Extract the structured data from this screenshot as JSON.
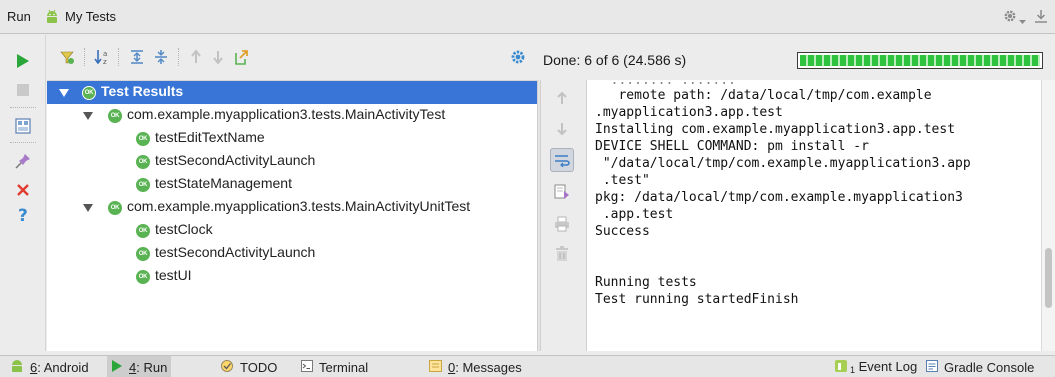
{
  "window": {
    "tool_label": "Run",
    "config_name": "My Tests",
    "icons": [
      "android-icon",
      "gear-icon",
      "hide-icon"
    ]
  },
  "left_toolbar": {
    "buttons": [
      "rerun-icon",
      "stop-icon",
      "layout-icon",
      "pin-icon",
      "close-icon",
      "help-icon"
    ]
  },
  "tree_toolbar": {
    "buttons": [
      "hide-passed-icon",
      "sort-alpha-icon",
      "expand-all-icon",
      "collapse-all-icon",
      "prev-failed-icon",
      "next-failed-icon",
      "export-icon",
      "settings-icon"
    ]
  },
  "tree": {
    "badge": "OK",
    "root": "Test Results",
    "groups": [
      {
        "name": "com.example.myapplication3.tests.MainActivityTest",
        "tests": [
          "testEditTextName",
          "testSecondActivityLaunch",
          "testStateManagement"
        ]
      },
      {
        "name": "com.example.myapplication3.tests.MainActivityUnitTest",
        "tests": [
          "testClock",
          "testSecondActivityLaunch",
          "testUI"
        ]
      }
    ]
  },
  "status": {
    "text": "Done: 6 of 6  (24.586 s)",
    "progress": 1.0,
    "progress_color": "#2fc23e"
  },
  "console": {
    "lines": [
      "   remote path: /data/local/tmp/com.example",
      ".myapplication3.app.test",
      "Installing com.example.myapplication3.app.test",
      "DEVICE SHELL COMMAND: pm install -r",
      " \"/data/local/tmp/com.example.myapplication3.app",
      " .test\"",
      "pkg: /data/local/tmp/com.example.myapplication3",
      " .app.test",
      "Success",
      "",
      "",
      "Running tests",
      "Test running startedFinish"
    ],
    "tools": [
      "up-icon",
      "down-icon",
      "soft-wrap-icon",
      "scroll-to-end-icon",
      "print-icon",
      "clear-icon"
    ]
  },
  "bottom_bar": {
    "tabs": [
      {
        "prefix": "6",
        "label": ": Android",
        "icon": "android-icon"
      },
      {
        "prefix": "4",
        "label": ": Run",
        "icon": "run-icon"
      },
      {
        "prefix": "",
        "label": "TODO",
        "icon": "todo-icon"
      },
      {
        "prefix": "",
        "label": "Terminal",
        "icon": "terminal-icon"
      },
      {
        "prefix": "0",
        "label": ": Messages",
        "icon": "messages-icon"
      }
    ],
    "right_tabs": [
      {
        "badge": "1",
        "label": "Event Log",
        "icon": "event-log-icon"
      },
      {
        "label": "Gradle Console",
        "icon": "gradle-console-icon"
      }
    ]
  },
  "colors": {
    "selection": "#3875d7",
    "ok_badge": "#5ab352",
    "run_green": "#2aa63a",
    "error_red": "#e23b30",
    "help_blue": "#3a8ad0"
  }
}
